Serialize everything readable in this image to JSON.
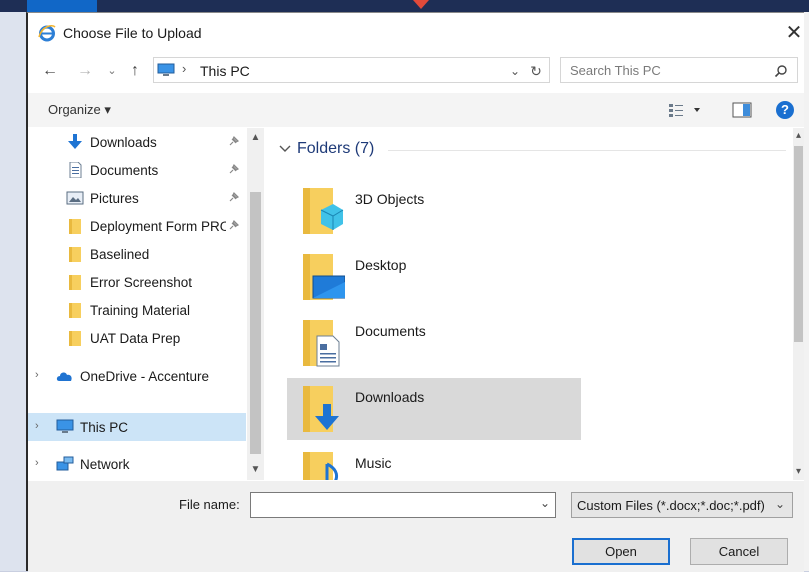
{
  "window": {
    "title": "Choose File to Upload"
  },
  "address": {
    "location": "This PC"
  },
  "search": {
    "placeholder": "Search This PC"
  },
  "toolbar": {
    "organize_label": "Organize ▾",
    "help_label": "?"
  },
  "nav": {
    "quick_access": [
      {
        "label": "Downloads",
        "icon": "download-arrow-icon",
        "pinned": true
      },
      {
        "label": "Documents",
        "icon": "document-icon",
        "pinned": true
      },
      {
        "label": "Pictures",
        "icon": "pictures-icon",
        "pinned": true
      },
      {
        "label": "Deployment Form PRO",
        "icon": "folder-icon",
        "pinned": true
      },
      {
        "label": "Baselined",
        "icon": "folder-icon",
        "pinned": false
      },
      {
        "label": "Error Screenshot",
        "icon": "folder-icon",
        "pinned": false
      },
      {
        "label": "Training Material",
        "icon": "folder-icon",
        "pinned": false
      },
      {
        "label": "UAT Data Prep",
        "icon": "folder-icon",
        "pinned": false
      }
    ],
    "roots": [
      {
        "label": "OneDrive - Accenture",
        "icon": "cloud-icon"
      },
      {
        "label": "This PC",
        "icon": "computer-icon",
        "selected": true
      },
      {
        "label": "Network",
        "icon": "network-icon"
      }
    ]
  },
  "content": {
    "group_label": "Folders (7)",
    "folders": [
      {
        "label": "3D Objects",
        "icon": "3d-objects-folder-icon"
      },
      {
        "label": "Desktop",
        "icon": "desktop-folder-icon"
      },
      {
        "label": "Documents",
        "icon": "documents-folder-icon"
      },
      {
        "label": "Downloads",
        "icon": "downloads-folder-icon",
        "selected": true
      },
      {
        "label": "Music",
        "icon": "music-folder-icon"
      }
    ]
  },
  "footer": {
    "file_name_label": "File name:",
    "file_name_value": "",
    "file_type_value": "Custom Files (*.docx;*.doc;*.pdf)",
    "open_label": "Open",
    "cancel_label": "Cancel"
  },
  "colors": {
    "accent": "#1a6fd0",
    "selection": "#cce4f7",
    "folder": "#f7cf5e"
  }
}
